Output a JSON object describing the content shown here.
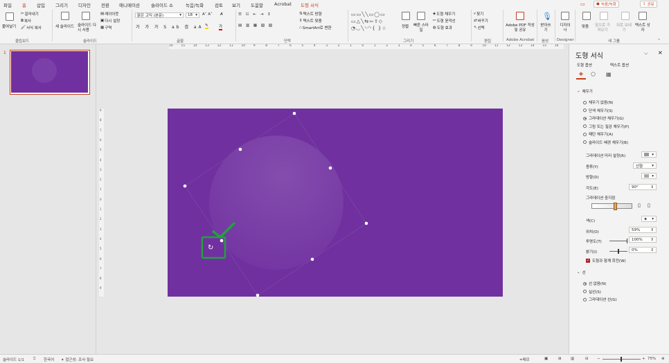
{
  "tabs": [
    "파일",
    "홈",
    "삽입",
    "그리기",
    "디자인",
    "전환",
    "애니메이션",
    "슬라이드 쇼",
    "녹음/녹화",
    "검토",
    "보기",
    "도움말",
    "Acrobat",
    "도형 서식"
  ],
  "active_tab": "홈",
  "top_buttons": {
    "record": "녹음/녹화",
    "share": "공유"
  },
  "ribbon": {
    "clipboard": {
      "paste": "붙여넣기",
      "cut": "잘라내기",
      "copy": "복사",
      "format_painter": "서식 복사",
      "label": "클립보드"
    },
    "slides": {
      "new_slide": "새 슬라이드",
      "reuse": "슬라이드 다시 사용",
      "layout": "레이아웃",
      "reset": "다시 설정",
      "section": "구역",
      "label": "슬라이드"
    },
    "font": {
      "name": "맑은 고딕 (본문)",
      "size": "18",
      "label": "글꼴"
    },
    "paragraph": {
      "text_direction": "텍스트 방향",
      "align_text": "텍스트 맞춤",
      "smartart": "SmartArt로 변환",
      "label": "단락"
    },
    "drawing": {
      "arrange": "정렬",
      "quick_styles": "빠른 스타일",
      "fill": "도형 채우기",
      "outline": "도형 윤곽선",
      "effects": "도형 효과",
      "label": "그리기"
    },
    "editing": {
      "find": "찾기",
      "replace": "바꾸기",
      "select": "선택",
      "label": "편집"
    },
    "acrobat": {
      "create_pdf": "Adobe PDF 작성 및 공유",
      "label": "Adobe Acrobat"
    },
    "voice": {
      "dictate": "받아쓰기",
      "label": "음성"
    },
    "designer": {
      "design_ideas": "디자이너",
      "label": "Designer"
    },
    "group": {
      "align": "맞춤",
      "bring_forward": "앞으로 가져오기",
      "send_backward": "뒤로 보내기",
      "text_box": "텍스트 상자",
      "label": "새 그룹"
    }
  },
  "ruler_marks": [
    "16",
    "15",
    "14",
    "13",
    "12",
    "11",
    "10",
    "9",
    "8",
    "7",
    "6",
    "5",
    "4",
    "3",
    "2",
    "1",
    "0",
    "1",
    "2",
    "3",
    "4",
    "5",
    "6",
    "7",
    "8",
    "9",
    "10",
    "11",
    "12",
    "13",
    "14",
    "15",
    "16"
  ],
  "vruler_marks": [
    "9",
    "8",
    "7",
    "6",
    "5",
    "4",
    "3",
    "2",
    "1",
    "0",
    "1",
    "2",
    "3",
    "4",
    "5",
    "6",
    "7",
    "8",
    "9"
  ],
  "slide_number": "1",
  "colors": {
    "slide_bg": "#7030a0",
    "accent": "#c43e1c",
    "check": "#1fa33a"
  },
  "pane": {
    "title": "도형 서식",
    "tab_shape": "도형 옵션",
    "tab_text": "텍스트 옵션",
    "fill_section": "채우기",
    "fill_options": [
      "채우기 없음(N)",
      "단색 채우기(S)",
      "그라데이션 채우기(G)",
      "그림 또는 질감 채우기(P)",
      "패턴 채우기(A)",
      "슬라이드 배경 채우기(B)"
    ],
    "fill_selected": 2,
    "preset_label": "그라데이션 미리 설정(R)",
    "type_label": "종류(Y)",
    "type_value": "선형",
    "direction_label": "방향(D)",
    "angle_label": "각도(E)",
    "angle_value": "90°",
    "stops_label": "그라데이션 중지점",
    "stop_position": 0.58,
    "color_label": "색(C)",
    "position_label": "위치(O)",
    "position_value": "59%",
    "transparency_label": "투명도(T)",
    "transparency_value": "100%",
    "brightness_label": "밝기(I)",
    "brightness_value": "0%",
    "rotate_label": "도형과 함께 회전(W)",
    "line_section": "선",
    "line_options": [
      "선 없음(N)",
      "실선(S)",
      "그라데이션 선(G)"
    ],
    "line_selected": 0
  },
  "status": {
    "slide": "슬라이드 1/1",
    "language": "한국어",
    "accessibility": "접근성: 조사 필요",
    "notes": "메모",
    "zoom": "75%"
  }
}
